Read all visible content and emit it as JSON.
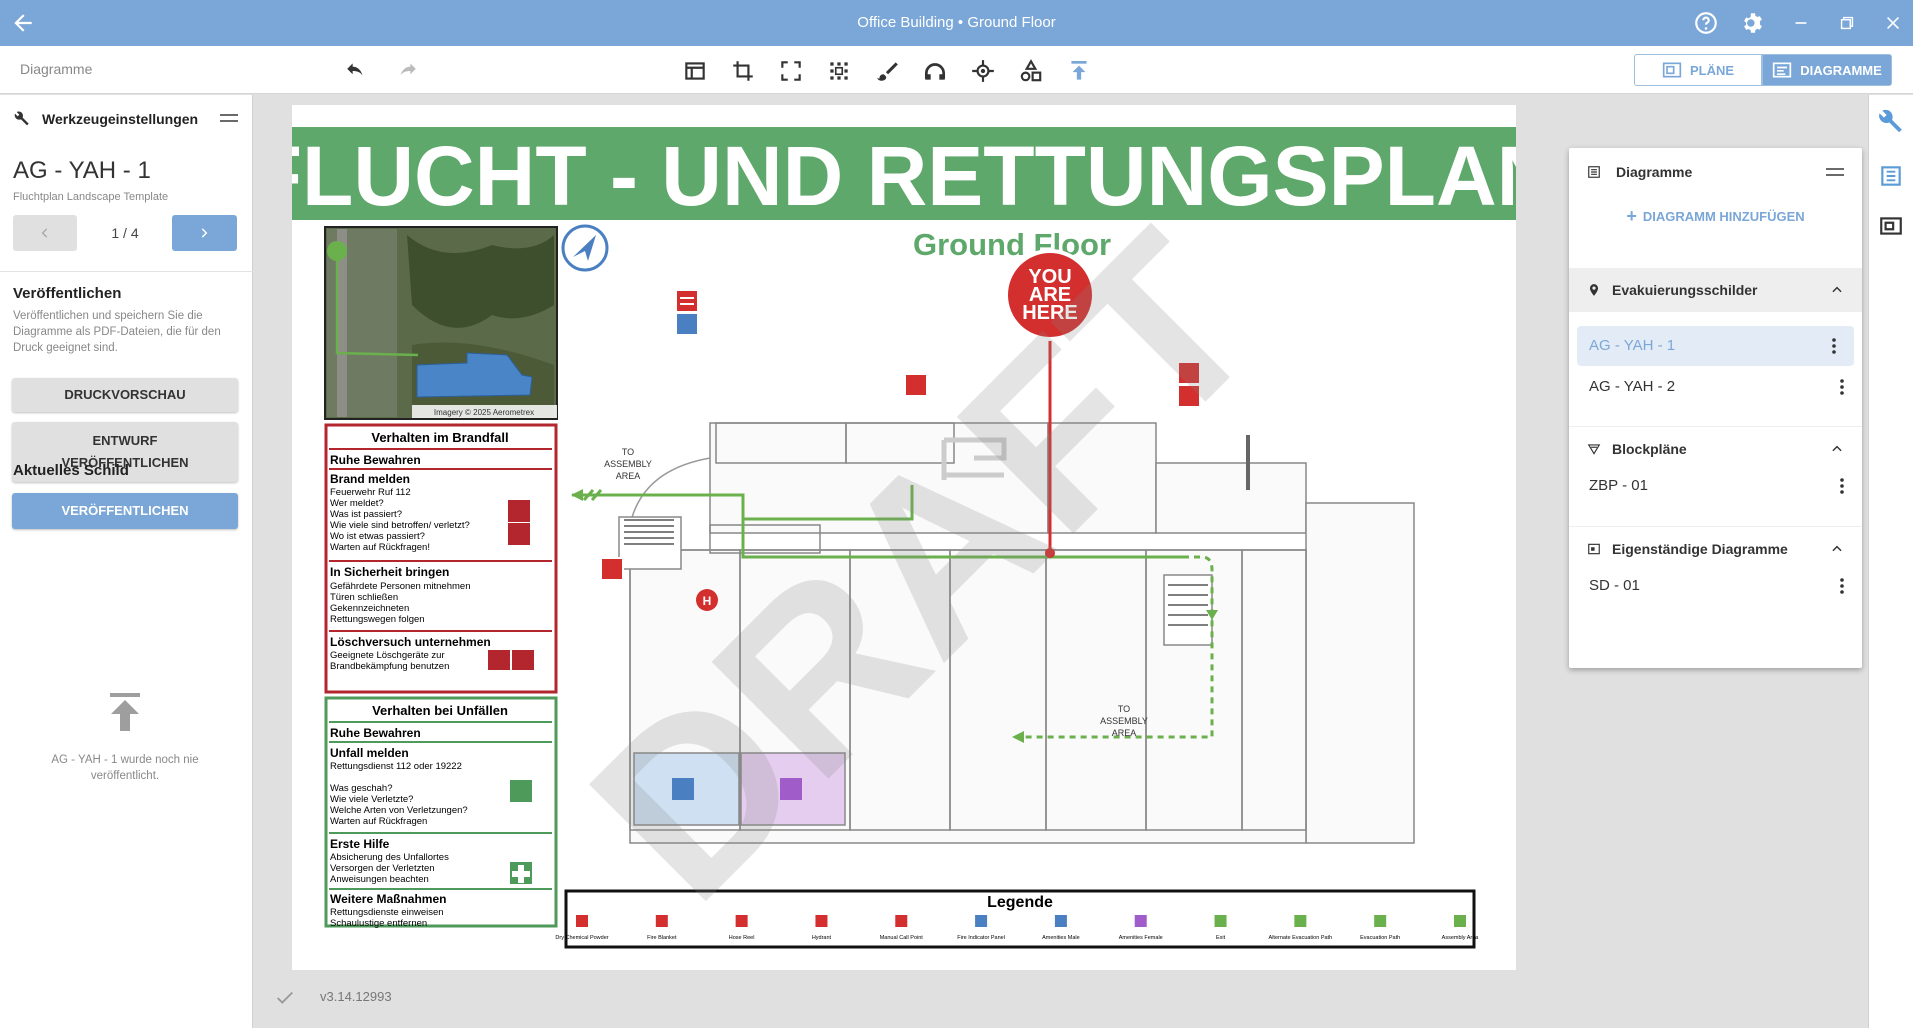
{
  "window": {
    "title": "Office Building • Ground Floor"
  },
  "toolbar": {
    "breadcrumb": "Diagramme",
    "plans_label": "PLÄNE",
    "diagrams_label": "DIAGRAMME"
  },
  "left_panel": {
    "header": "Werkzeugeinstellungen",
    "sign_title": "AG - YAH - 1",
    "template": "Fluchtplan Landscape Template",
    "pager": "1 / 4",
    "publish_heading": "Veröffentlichen",
    "publish_description": "Veröffentlichen und speichern Sie die Diagramme als PDF-Dateien, die für den Druck geeignet sind.",
    "print_preview": "DRUCKVORSCHAU",
    "draft_publish_line1": "ENTWURF",
    "draft_publish_line2": "VERÖFFENTLICHEN",
    "publish": "VERÖFFENTLICHEN",
    "current_sign_heading": "Aktuelles Schild",
    "not_published": "AG - YAH - 1 wurde noch nie veröffentlicht."
  },
  "plan": {
    "title": "FLUCHT - UND RETTUNGSPLAN",
    "floor": "Ground Floor",
    "watermark": "DRAFT",
    "imagery_credit": "Imagery © 2025 Aerometrex",
    "you_are_here": [
      "YOU",
      "ARE",
      "HERE"
    ],
    "assembly_area_1": [
      "TO",
      "ASSEMBLY",
      "AREA"
    ],
    "assembly_area_2": [
      "TO",
      "ASSEMBLY",
      "AREA"
    ],
    "fire_box": {
      "title": "Verhalten im Brandfall",
      "calm": "Ruhe Bewahren",
      "report_heading": "Brand melden",
      "report_lines": [
        "Feuerwehr Ruf 112",
        "Wer meldet?",
        "Was ist passiert?",
        "Wie viele sind betroffen/ verletzt?",
        "Wo ist etwas passiert?",
        "Warten auf Rückfragen!"
      ],
      "safety_heading": "In Sicherheit bringen",
      "safety_lines": [
        "Gefährdete Personen mitnehmen",
        "Türen schließen",
        "Gekennzeichneten",
        "Rettungswegen folgen"
      ],
      "extinguish_heading": "Löschversuch unternehmen",
      "extinguish_lines": [
        "Geeignete Löschgeräte zur",
        "Brandbekämpfung benutzen"
      ]
    },
    "accident_box": {
      "title": "Verhalten bei Unfällen",
      "calm": "Ruhe Bewahren",
      "report_heading": "Unfall melden",
      "report_lines": [
        "Rettungsdienst 112 oder 19222",
        "",
        "Was geschah?",
        "Wie viele Verletzte?",
        "Welche Arten von Verletzungen?",
        "Warten auf Rückfragen"
      ],
      "first_aid_heading": "Erste Hilfe",
      "first_aid_lines": [
        "Absicherung des Unfallortes",
        "Versorgen der Verletzten",
        "Anweisungen beachten"
      ],
      "further_heading": "Weitere Maßnahmen",
      "further_lines": [
        "Rettungsdienste einweisen",
        "Schaulustige entfernen"
      ]
    },
    "legend": {
      "title": "Legende",
      "items": [
        {
          "label": "Dry Chemical Powder",
          "color": "#d32f2f"
        },
        {
          "label": "Fire Blanket",
          "color": "#d32f2f"
        },
        {
          "label": "Hose Reel",
          "color": "#d32f2f"
        },
        {
          "label": "Hydrant",
          "color": "#d32f2f"
        },
        {
          "label": "Manual Call Point",
          "color": "#d32f2f"
        },
        {
          "label": "Fire Indicator Panel",
          "color": "#4a7fc1"
        },
        {
          "label": "Amenities Male",
          "color": "#4a7fc1"
        },
        {
          "label": "Amenities Female",
          "color": "#a05cc8"
        },
        {
          "label": "Exit",
          "color": "#6ab04c"
        },
        {
          "label": "Alternate Evacuation Path",
          "color": "#6ab04c"
        },
        {
          "label": "Evacuation Path",
          "color": "#6ab04c"
        },
        {
          "label": "Assembly Area",
          "color": "#6ab04c"
        }
      ]
    }
  },
  "footer": {
    "version": "v3.14.12993"
  },
  "diagrams_panel": {
    "header": "Diagramme",
    "add_label": "DIAGRAMM HINZUFÜGEN",
    "sections": [
      {
        "title": "Evakuierungsschilder",
        "items": [
          "AG - YAH - 1",
          "AG - YAH - 2"
        ]
      },
      {
        "title": "Blockpläne",
        "items": [
          "ZBP - 01"
        ]
      },
      {
        "title": "Eigenständige Diagramme",
        "items": [
          "SD - 01"
        ]
      }
    ]
  },
  "colors": {
    "accent": "#7aa7d7",
    "plan_header_green": "#5fa86b",
    "fire_red": "#b3262e",
    "evac_green": "#6ab04c"
  }
}
